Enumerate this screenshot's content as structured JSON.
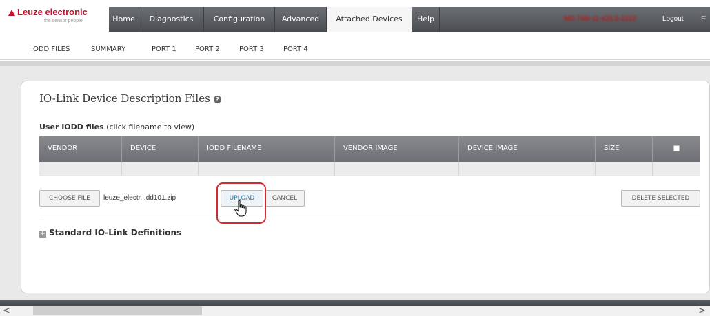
{
  "brand": {
    "name": "Leuze electronic",
    "tagline": "the sensor people",
    "color": "#c8102e"
  },
  "nav": {
    "tabs": [
      {
        "label": "Home"
      },
      {
        "label": "Diagnostics"
      },
      {
        "label": "Configuration"
      },
      {
        "label": "Advanced"
      },
      {
        "label": "Attached Devices",
        "active": true
      },
      {
        "label": "Help"
      }
    ],
    "status_text": "MD 748i-11-42/L5-2222",
    "logout_label": "Logout",
    "overflow_label": "E"
  },
  "subnav": {
    "items": [
      "IODD FILES",
      "SUMMARY",
      "PORT 1",
      "PORT 2",
      "PORT 3",
      "PORT 4"
    ]
  },
  "panel": {
    "title": "IO-Link Device Description Files",
    "user_files_label": "User IODD files",
    "user_files_hint": "(click filename to view)",
    "table": {
      "columns": [
        "VENDOR",
        "DEVICE",
        "IODD FILENAME",
        "VENDOR IMAGE",
        "DEVICE IMAGE",
        "SIZE"
      ],
      "rows": []
    },
    "choose_file_label": "CHOOSE FILE",
    "selected_file": "leuze_electr...dd101.zip",
    "upload_label": "UPLOAD",
    "cancel_label": "CANCEL",
    "delete_selected_label": "DELETE SELECTED",
    "standard_defs_label": "Standard IO-Link Definitions"
  },
  "scrollbar": {
    "left_arrow": "<",
    "right_arrow": ">"
  }
}
